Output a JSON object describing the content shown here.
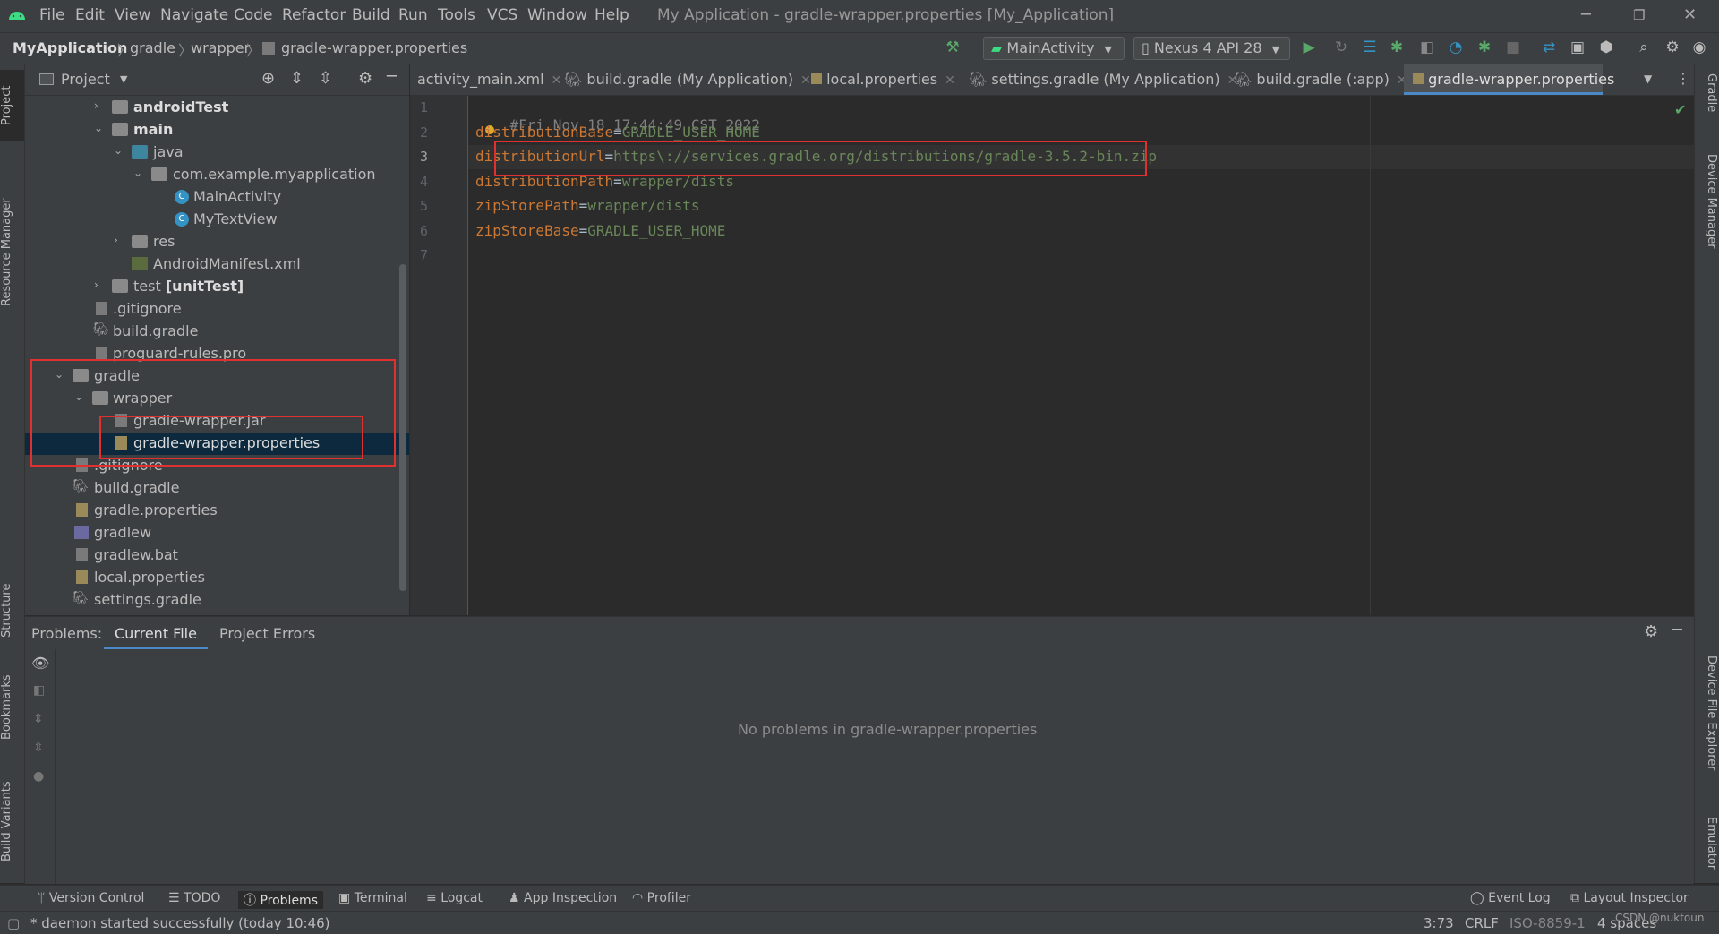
{
  "window": {
    "title": "My Application - gradle-wrapper.properties [My_Application]",
    "menu": [
      "File",
      "Edit",
      "View",
      "Navigate",
      "Code",
      "Refactor",
      "Build",
      "Run",
      "Tools",
      "VCS",
      "Window",
      "Help"
    ]
  },
  "breadcrumb": [
    "MyApplication",
    "gradle",
    "wrapper",
    "gradle-wrapper.properties"
  ],
  "run_config": "MainActivity",
  "device": "Nexus 4 API 28",
  "project_panel": {
    "title": "Project",
    "tree": [
      {
        "label": "androidTest",
        "type": "folder",
        "expanded": false,
        "bold": true
      },
      {
        "label": "main",
        "type": "folder",
        "expanded": true,
        "bold": true
      },
      {
        "label": "java",
        "type": "folder-blue",
        "expanded": true
      },
      {
        "label": "com.example.myapplication",
        "type": "package",
        "expanded": true
      },
      {
        "label": "MainActivity",
        "type": "class"
      },
      {
        "label": "MyTextView",
        "type": "class"
      },
      {
        "label": "res",
        "type": "folder",
        "expanded": false
      },
      {
        "label": "AndroidManifest.xml",
        "type": "xml"
      },
      {
        "label": "test",
        "suffix": "[unitTest]",
        "type": "folder",
        "expanded": false
      },
      {
        "label": ".gitignore",
        "type": "file"
      },
      {
        "label": "build.gradle",
        "type": "gradle"
      },
      {
        "label": "proguard-rules.pro",
        "type": "file"
      },
      {
        "label": "gradle",
        "type": "folder",
        "expanded": true
      },
      {
        "label": "wrapper",
        "type": "folder",
        "expanded": true
      },
      {
        "label": "gradle-wrapper.jar",
        "type": "jar"
      },
      {
        "label": "gradle-wrapper.properties",
        "type": "props",
        "selected": true
      },
      {
        "label": ".gitignore",
        "type": "file"
      },
      {
        "label": "build.gradle",
        "type": "gradle"
      },
      {
        "label": "gradle.properties",
        "type": "props"
      },
      {
        "label": "gradlew",
        "type": "file"
      },
      {
        "label": "gradlew.bat",
        "type": "file"
      },
      {
        "label": "local.properties",
        "type": "props"
      },
      {
        "label": "settings.gradle",
        "type": "gradle"
      }
    ]
  },
  "editor_tabs": [
    {
      "label": "activity_main.xml"
    },
    {
      "label": "build.gradle (My Application)"
    },
    {
      "label": "local.properties"
    },
    {
      "label": "settings.gradle (My Application)"
    },
    {
      "label": "build.gradle (:app)"
    },
    {
      "label": "gradle-wrapper.properties",
      "active": true
    }
  ],
  "code_lines": [
    {
      "num": "1",
      "comment": "#Fri Nov 18 17:44:49 CST 2022"
    },
    {
      "num": "2",
      "key": "distributionBase",
      "val": "GRADLE_USER_HOME"
    },
    {
      "num": "3",
      "key": "distributionUrl",
      "val": "https\\://services.gradle.org/distributions/gradle-3.5.2-bin.zip"
    },
    {
      "num": "4",
      "key": "distributionPath",
      "val": "wrapper/dists"
    },
    {
      "num": "5",
      "key": "zipStorePath",
      "val": "wrapper/dists"
    },
    {
      "num": "6",
      "key": "zipStoreBase",
      "val": "GRADLE_USER_HOME"
    },
    {
      "num": "7"
    }
  ],
  "problems": {
    "title": "Problems:",
    "tabs": [
      "Current File",
      "Project Errors"
    ],
    "empty_message": "No problems in gradle-wrapper.properties"
  },
  "bottom_tools": [
    "Version Control",
    "TODO",
    "Problems",
    "Terminal",
    "Logcat",
    "App Inspection",
    "Profiler"
  ],
  "bottom_right_tools": [
    "Event Log",
    "Layout Inspector"
  ],
  "side_tabs_left": [
    "Project",
    "Resource Manager",
    "Structure",
    "Bookmarks",
    "Build Variants"
  ],
  "side_tabs_right": [
    "Gradle",
    "Device Manager",
    "Device File Explorer",
    "Emulator"
  ],
  "status": {
    "message": "* daemon started successfully (today 10:46)",
    "position": "3:73",
    "line_sep": "CRLF",
    "encoding": "ISO-8859-1",
    "indent": "4 spaces",
    "watermark": "CSDN @nuktoun"
  },
  "colors": {
    "accent": "#4a88c7",
    "highlight_box": "#e03030",
    "selection": "#0d293e"
  }
}
